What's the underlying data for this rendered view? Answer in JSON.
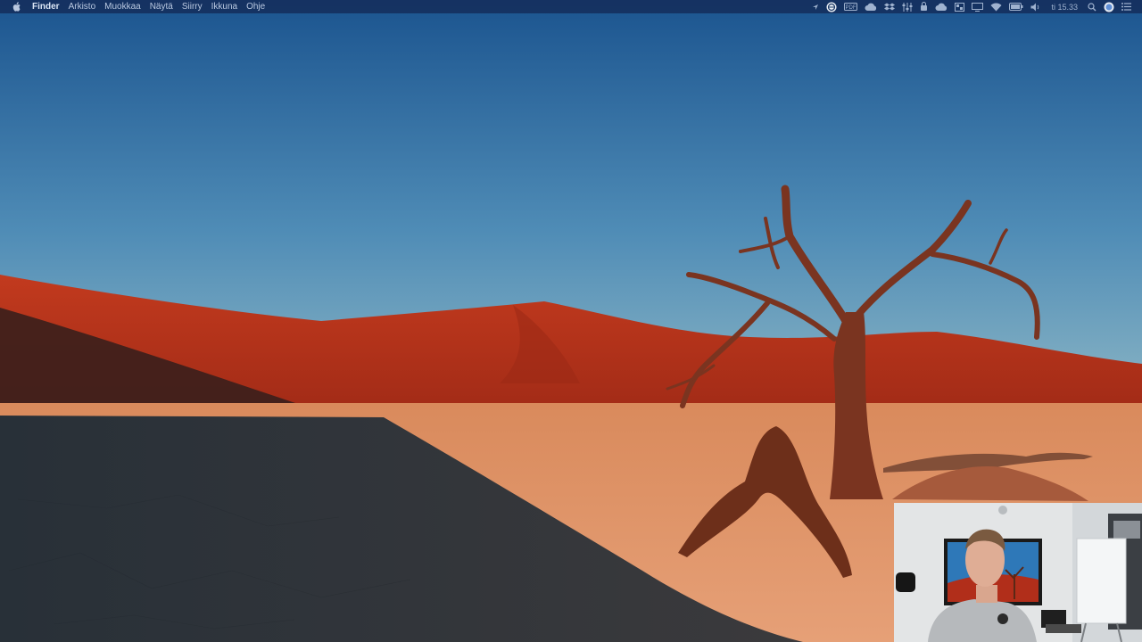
{
  "menubar": {
    "apple_icon": "apple-logo-icon",
    "app_name": "Finder",
    "menus": [
      "Arkisto",
      "Muokkaa",
      "Näytä",
      "Siirry",
      "Ikkuna",
      "Ohje"
    ],
    "clock": "ti 15.33",
    "status_icons": [
      "location-arrow-icon",
      "vpn-globe-icon",
      "pdf-icon",
      "creative-cloud-icon",
      "dropbox-icon",
      "equalizer-icon",
      "key-icon",
      "cloud-icon",
      "dashboard-icon",
      "display-icon",
      "wifi-icon",
      "battery-icon",
      "volume-icon",
      "search-icon",
      "siri-icon",
      "notification-list-icon"
    ]
  },
  "colors": {
    "sky_top": "#1d5a94",
    "sky_bottom": "#7fb0c8",
    "dune": "#b0301a",
    "pan_light": "#e09060",
    "pan_shadow": "#2e3540"
  }
}
